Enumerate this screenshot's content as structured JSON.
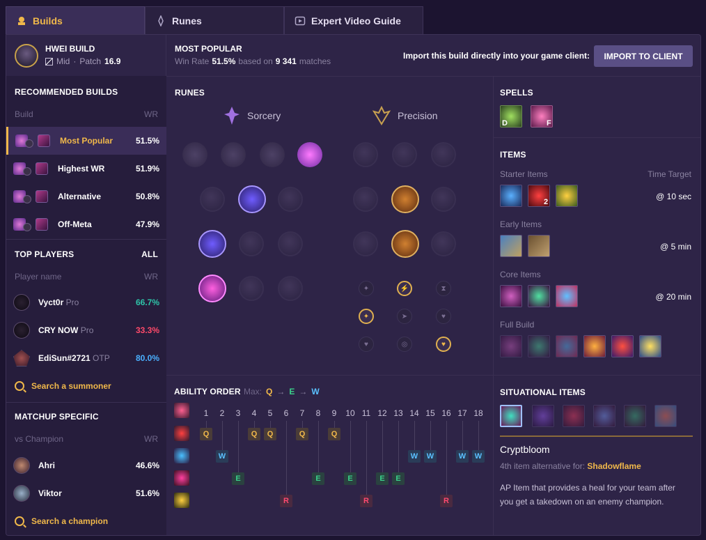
{
  "tabs": [
    {
      "label": "Builds"
    },
    {
      "label": "Runes"
    },
    {
      "label": "Expert Video Guide"
    }
  ],
  "header": {
    "champ_title": "HWEI BUILD",
    "role": "Mid",
    "patch_label": "Patch",
    "patch": "16.9",
    "popular_title": "MOST POPULAR",
    "winrate_label": "Win Rate",
    "winrate": "51.5%",
    "based_on": "based on",
    "matches": "9 341",
    "matches_label": "matches",
    "import_text": "Import this build directly into your game client:",
    "import_button": "IMPORT TO CLIENT"
  },
  "recommended": {
    "title": "RECOMMENDED BUILDS",
    "col_build": "Build",
    "col_wr": "WR",
    "items": [
      {
        "label": "Most Popular",
        "wr": "51.5%"
      },
      {
        "label": "Highest WR",
        "wr": "51.9%"
      },
      {
        "label": "Alternative",
        "wr": "50.8%"
      },
      {
        "label": "Off-Meta",
        "wr": "47.9%"
      }
    ]
  },
  "top_players": {
    "title": "TOP PLAYERS",
    "all": "ALL",
    "col_name": "Player name",
    "col_wr": "WR",
    "items": [
      {
        "name": "Vyct0r",
        "tag": "Pro",
        "wr": "66.7%",
        "color": "#2ec4a8"
      },
      {
        "name": "CRY NOW",
        "tag": "Pro",
        "wr": "33.3%",
        "color": "#ff4a6a"
      },
      {
        "name": "EdiSun#2721",
        "tag": "OTP",
        "wr": "80.0%",
        "color": "#4ab0ff"
      }
    ],
    "search": "Search a summoner"
  },
  "matchup": {
    "title": "MATCHUP SPECIFIC",
    "col_name": "vs Champion",
    "col_wr": "WR",
    "items": [
      {
        "name": "Ahri",
        "wr": "46.6%"
      },
      {
        "name": "Viktor",
        "wr": "51.6%"
      }
    ],
    "search": "Search a champion"
  },
  "runes": {
    "title": "RUNES",
    "primary": "Sorcery",
    "secondary": "Precision"
  },
  "spells": {
    "title": "SPELLS",
    "keys": [
      "D",
      "F"
    ]
  },
  "items": {
    "title": "ITEMS",
    "time_target": "Time Target",
    "groups": [
      {
        "label": "Starter Items",
        "time": "@ 10 sec",
        "count": "2"
      },
      {
        "label": "Early Items",
        "time": "@ 5 min"
      },
      {
        "label": "Core Items",
        "time": "@ 20 min"
      },
      {
        "label": "Full Build"
      }
    ]
  },
  "ability": {
    "title": "ABILITY ORDER",
    "max_label": "Max:",
    "order": [
      "Q",
      "E",
      "W"
    ],
    "levels": [
      "1",
      "2",
      "3",
      "4",
      "5",
      "6",
      "7",
      "8",
      "9",
      "10",
      "11",
      "12",
      "13",
      "14",
      "15",
      "16",
      "17",
      "18"
    ]
  },
  "situational": {
    "title": "SITUATIONAL ITEMS",
    "name": "Cryptbloom",
    "alt_prefix": "4th item alternative for:",
    "alt_item": "Shadowflame",
    "desc1": "AP Item that provides a heal for your team after",
    "desc2": "you get a takedown on an enemy champion."
  }
}
